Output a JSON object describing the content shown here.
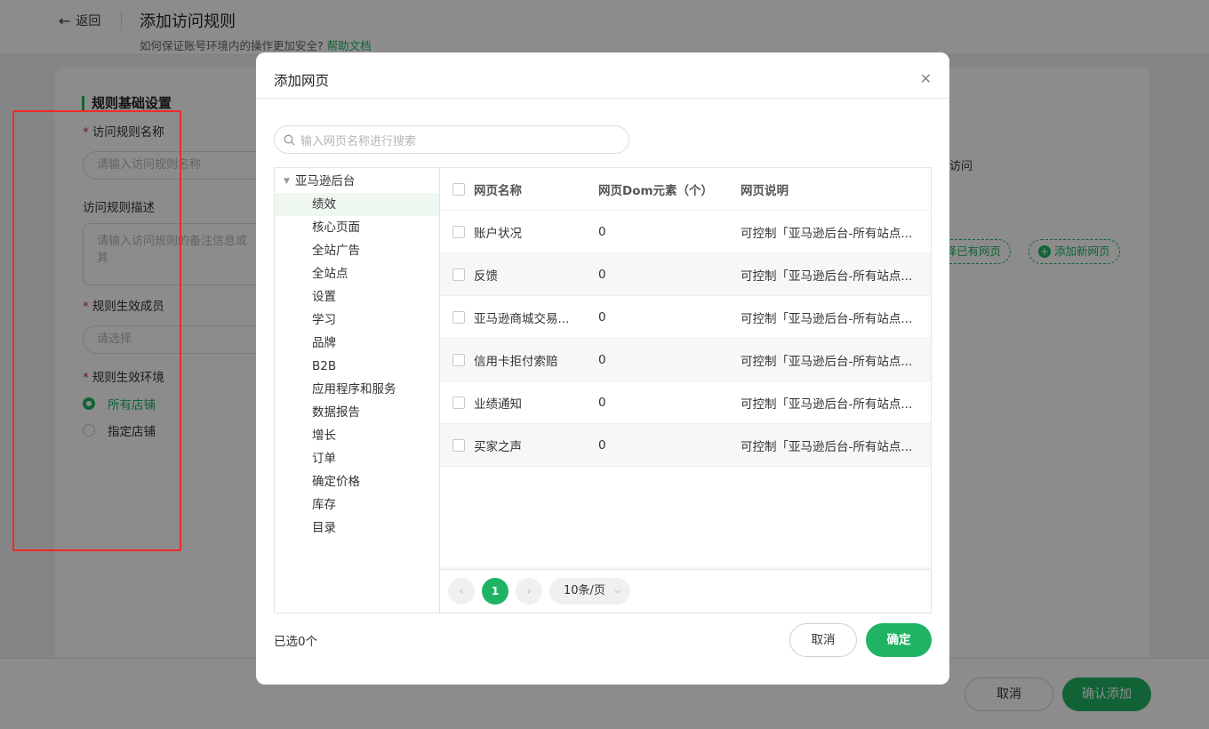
{
  "header": {
    "back_label": "返回",
    "title": "添加访问规则",
    "subtitle": "如何保证账号环境内的操作更加安全?",
    "help_link": "帮助文档"
  },
  "form": {
    "section_title": "规则基础设置",
    "name_label": "访问规则名称",
    "name_placeholder": "请输入访问规则名称",
    "desc_label": "访问规则描述",
    "desc_placeholder": "请输入访问规则的备注信息或其",
    "members_label": "规则生效成员",
    "members_placeholder": "请选择",
    "env_label": "规则生效环境",
    "env_options": [
      "所有店铺",
      "指定店铺"
    ],
    "env_selected": "所有店铺",
    "right_text": "访问",
    "select_existing_btn": "选择已有网页",
    "add_new_btn": "添加新网页"
  },
  "footer": {
    "cancel_label": "取消",
    "confirm_label": "确认添加"
  },
  "modal": {
    "title": "添加网页",
    "search_placeholder": "输入网页名称进行搜索",
    "tree": {
      "root": "亚马逊后台",
      "items": [
        "绩效",
        "核心页面",
        "全站广告",
        "全站点",
        "设置",
        "学习",
        "品牌",
        "B2B",
        "应用程序和服务",
        "数据报告",
        "增长",
        "订单",
        "确定价格",
        "库存",
        "目录"
      ],
      "active": "绩效"
    },
    "table": {
      "columns": [
        "网页名称",
        "网页Dom元素（个）",
        "网页说明"
      ],
      "rows": [
        {
          "name": "账户状况",
          "dom": "0",
          "desc": "可控制「亚马逊后台-所有站点..."
        },
        {
          "name": "反馈",
          "dom": "0",
          "desc": "可控制「亚马逊后台-所有站点..."
        },
        {
          "name": "亚马逊商城交易...",
          "dom": "0",
          "desc": "可控制「亚马逊后台-所有站点..."
        },
        {
          "name": "信用卡拒付索赔",
          "dom": "0",
          "desc": "可控制「亚马逊后台-所有站点..."
        },
        {
          "name": "业绩通知",
          "dom": "0",
          "desc": "可控制「亚马逊后台-所有站点..."
        },
        {
          "name": "买家之声",
          "dom": "0",
          "desc": "可控制「亚马逊后台-所有站点..."
        }
      ]
    },
    "pagination": {
      "current_page": "1",
      "page_size": "10条/页"
    },
    "selected_count": "已选0个",
    "cancel_label": "取消",
    "confirm_label": "确定"
  },
  "colors": {
    "accent": "#1fb463",
    "highlight_border": "#f02a2a"
  }
}
